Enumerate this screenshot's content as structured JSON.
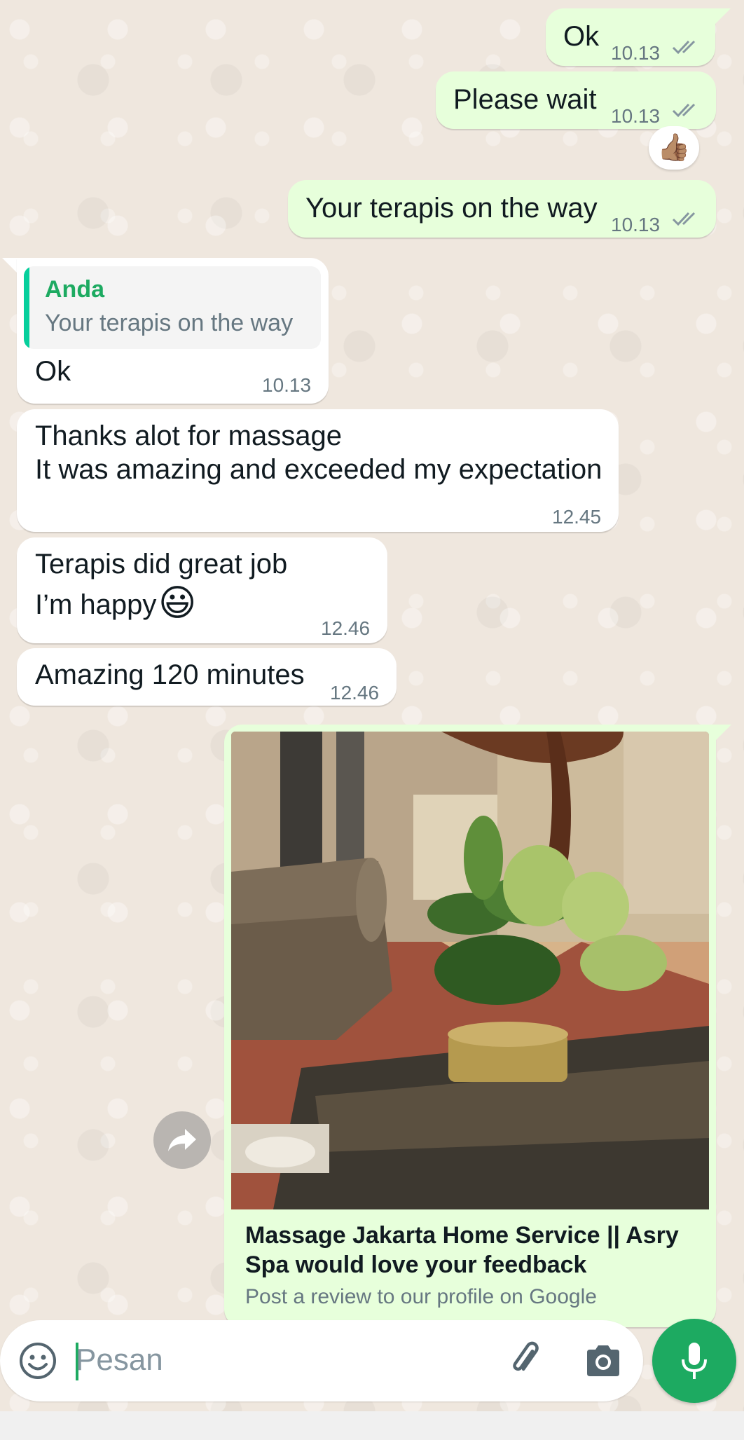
{
  "messages": {
    "m1": {
      "text": "Ok",
      "time": "10.13"
    },
    "m2": {
      "text": "Please wait",
      "time": "10.13",
      "reaction": "👍🏽"
    },
    "m3": {
      "text": "Your terapis on the way",
      "time": "10.13"
    },
    "m4": {
      "quote_author": "Anda",
      "quote_text": "Your terapis on the way",
      "text": "Ok",
      "time": "10.13"
    },
    "m5": {
      "line1": "Thanks alot for massage",
      "line2": "It was amazing and exceeded my expectation",
      "time": "12.45"
    },
    "m6": {
      "line1": "Terapis did great job",
      "line2": "I’m happy",
      "emoji": "😃",
      "time": "12.46"
    },
    "m7": {
      "text": "Amazing 120 minutes",
      "time": "12.46"
    },
    "m8": {
      "link_title": "Massage Jakarta Home Service || Asry Spa would love your feedback",
      "link_subtitle": "Post a review to our profile on Google"
    }
  },
  "composer": {
    "placeholder": "Pesan"
  },
  "colors": {
    "outgoing": "#e7ffdb",
    "incoming": "#ffffff",
    "accent": "#1daa61",
    "ticks": "#8696a0"
  },
  "icons": [
    "double-check-icon",
    "forward-icon",
    "emoji-icon",
    "attach-icon",
    "camera-icon",
    "mic-icon"
  ]
}
